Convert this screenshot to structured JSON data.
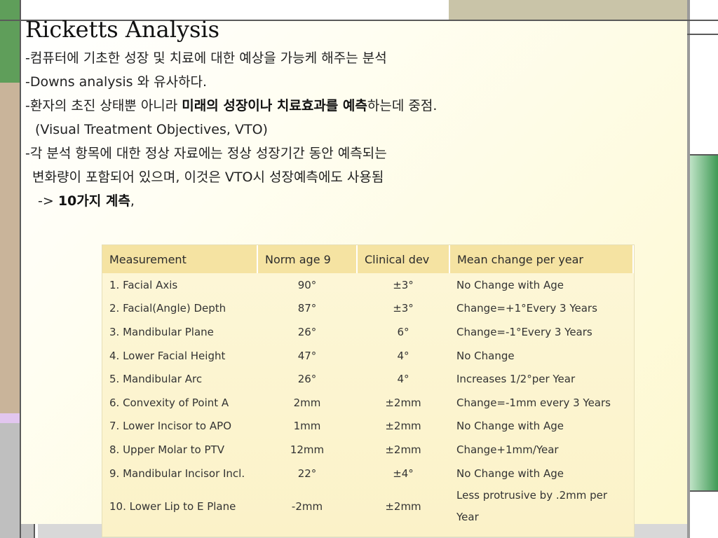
{
  "slide": {
    "title": "Ricketts Analysis",
    "lines": [
      "-컴퓨터에 기초한 성장 및 치료에 대한 예상을 가능케 해주는 분석",
      "-Downs analysis 와 유사하다.",
      "-환자의 초진 상태뿐 아니라 ",
      "미래의 성장이나 치료효과를 예측",
      "하는데 중점.",
      "(Visual Treatment Objectives, VTO)",
      "-각 분석 항목에 대한 정상 자료에는 정상 성장기간 동안 예측되는",
      "변화량이 포함되어 있으며, 이것은 VTO시 성장예측에도 사용됨",
      "-> ",
      "10가지 계측",
      ","
    ]
  },
  "table": {
    "headers": [
      "Measurement",
      "Norm age 9",
      "Clinical dev",
      "Mean change per year"
    ],
    "rows": [
      [
        "1. Facial Axis",
        "90°",
        "±3°",
        "No Change with Age"
      ],
      [
        "2. Facial(Angle) Depth",
        "87°",
        "±3°",
        "Change=+1°Every 3 Years"
      ],
      [
        "3. Mandibular Plane",
        "26°",
        "6°",
        "Change=-1°Every 3 Years"
      ],
      [
        "4. Lower Facial Height",
        "47°",
        "4°",
        "No Change"
      ],
      [
        "5. Mandibular Arc",
        "26°",
        "4°",
        "Increases 1/2°per Year"
      ],
      [
        "6. Convexity of Point A",
        "2mm",
        "±2mm",
        "Change=-1mm every 3 Years"
      ],
      [
        "7. Lower Incisor to APO",
        "1mm",
        "±2mm",
        "No Change with Age"
      ],
      [
        "8. Upper Molar to PTV",
        "12mm",
        "±2mm",
        "Change+1mm/Year"
      ],
      [
        "9. Mandibular Incisor Incl.",
        "22°",
        "±4°",
        "No Change with Age"
      ],
      [
        "10. Lower Lip to E Plane",
        "-2mm",
        "±2mm",
        "Less protrusive by .2mm per Year"
      ]
    ]
  }
}
